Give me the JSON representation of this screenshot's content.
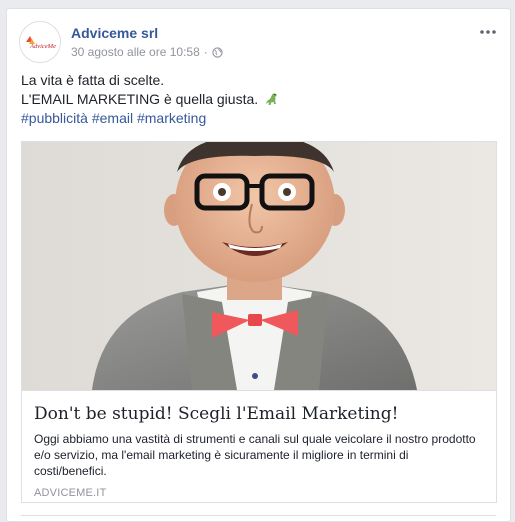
{
  "post": {
    "author": "Adviceme srl",
    "timestamp": "30 agosto alle ore 10:58",
    "separator": "·",
    "avatar_text": "AdviceMe",
    "text_line1": "La vita è fatta di scelte.",
    "text_line2": "L'EMAIL MARKETING è quella giusta.",
    "hashtags": [
      "#pubblicità",
      "#email",
      "#marketing"
    ],
    "icons": {
      "privacy": "globe-icon",
      "menu": "more-icon",
      "emoji": "dinosaur-icon"
    }
  },
  "link_preview": {
    "title": "Don't be stupid! Scegli l'Email Marketing!",
    "description": "Oggi abbiamo una vastità di strumenti e canali sul quale veicolare il nostro prodotto e/o servizio, ma l'email marketing è sicuramente il migliore in termini di costi/benefici.",
    "domain": "ADVICEME.IT"
  },
  "colors": {
    "link_blue": "#365899",
    "meta_gray": "#90949c",
    "text": "#1d2129",
    "bow_tie": "#f0595c"
  }
}
